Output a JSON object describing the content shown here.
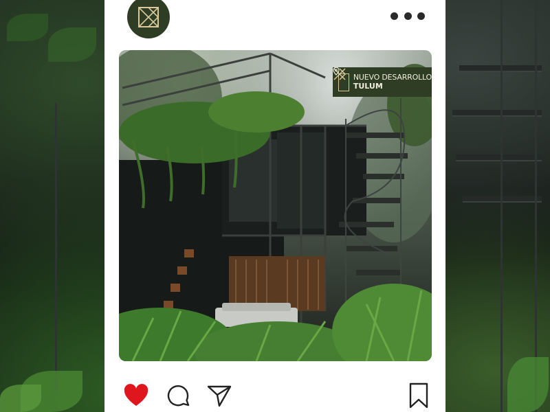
{
  "post": {
    "badge": {
      "line1": "NUEVO DESARROLLO",
      "line2": "TULUM"
    }
  },
  "icons": {
    "avatar": "brand-logo-icon",
    "more": "more-options-icon",
    "like": "heart-icon",
    "comment": "comment-icon",
    "share": "send-icon",
    "save": "bookmark-icon",
    "location": "location-pin-icon"
  },
  "colors": {
    "brand_green": "#2e3d24",
    "brand_gold": "#d9c99a",
    "like_red": "#e0161e"
  },
  "state": {
    "liked": true
  }
}
